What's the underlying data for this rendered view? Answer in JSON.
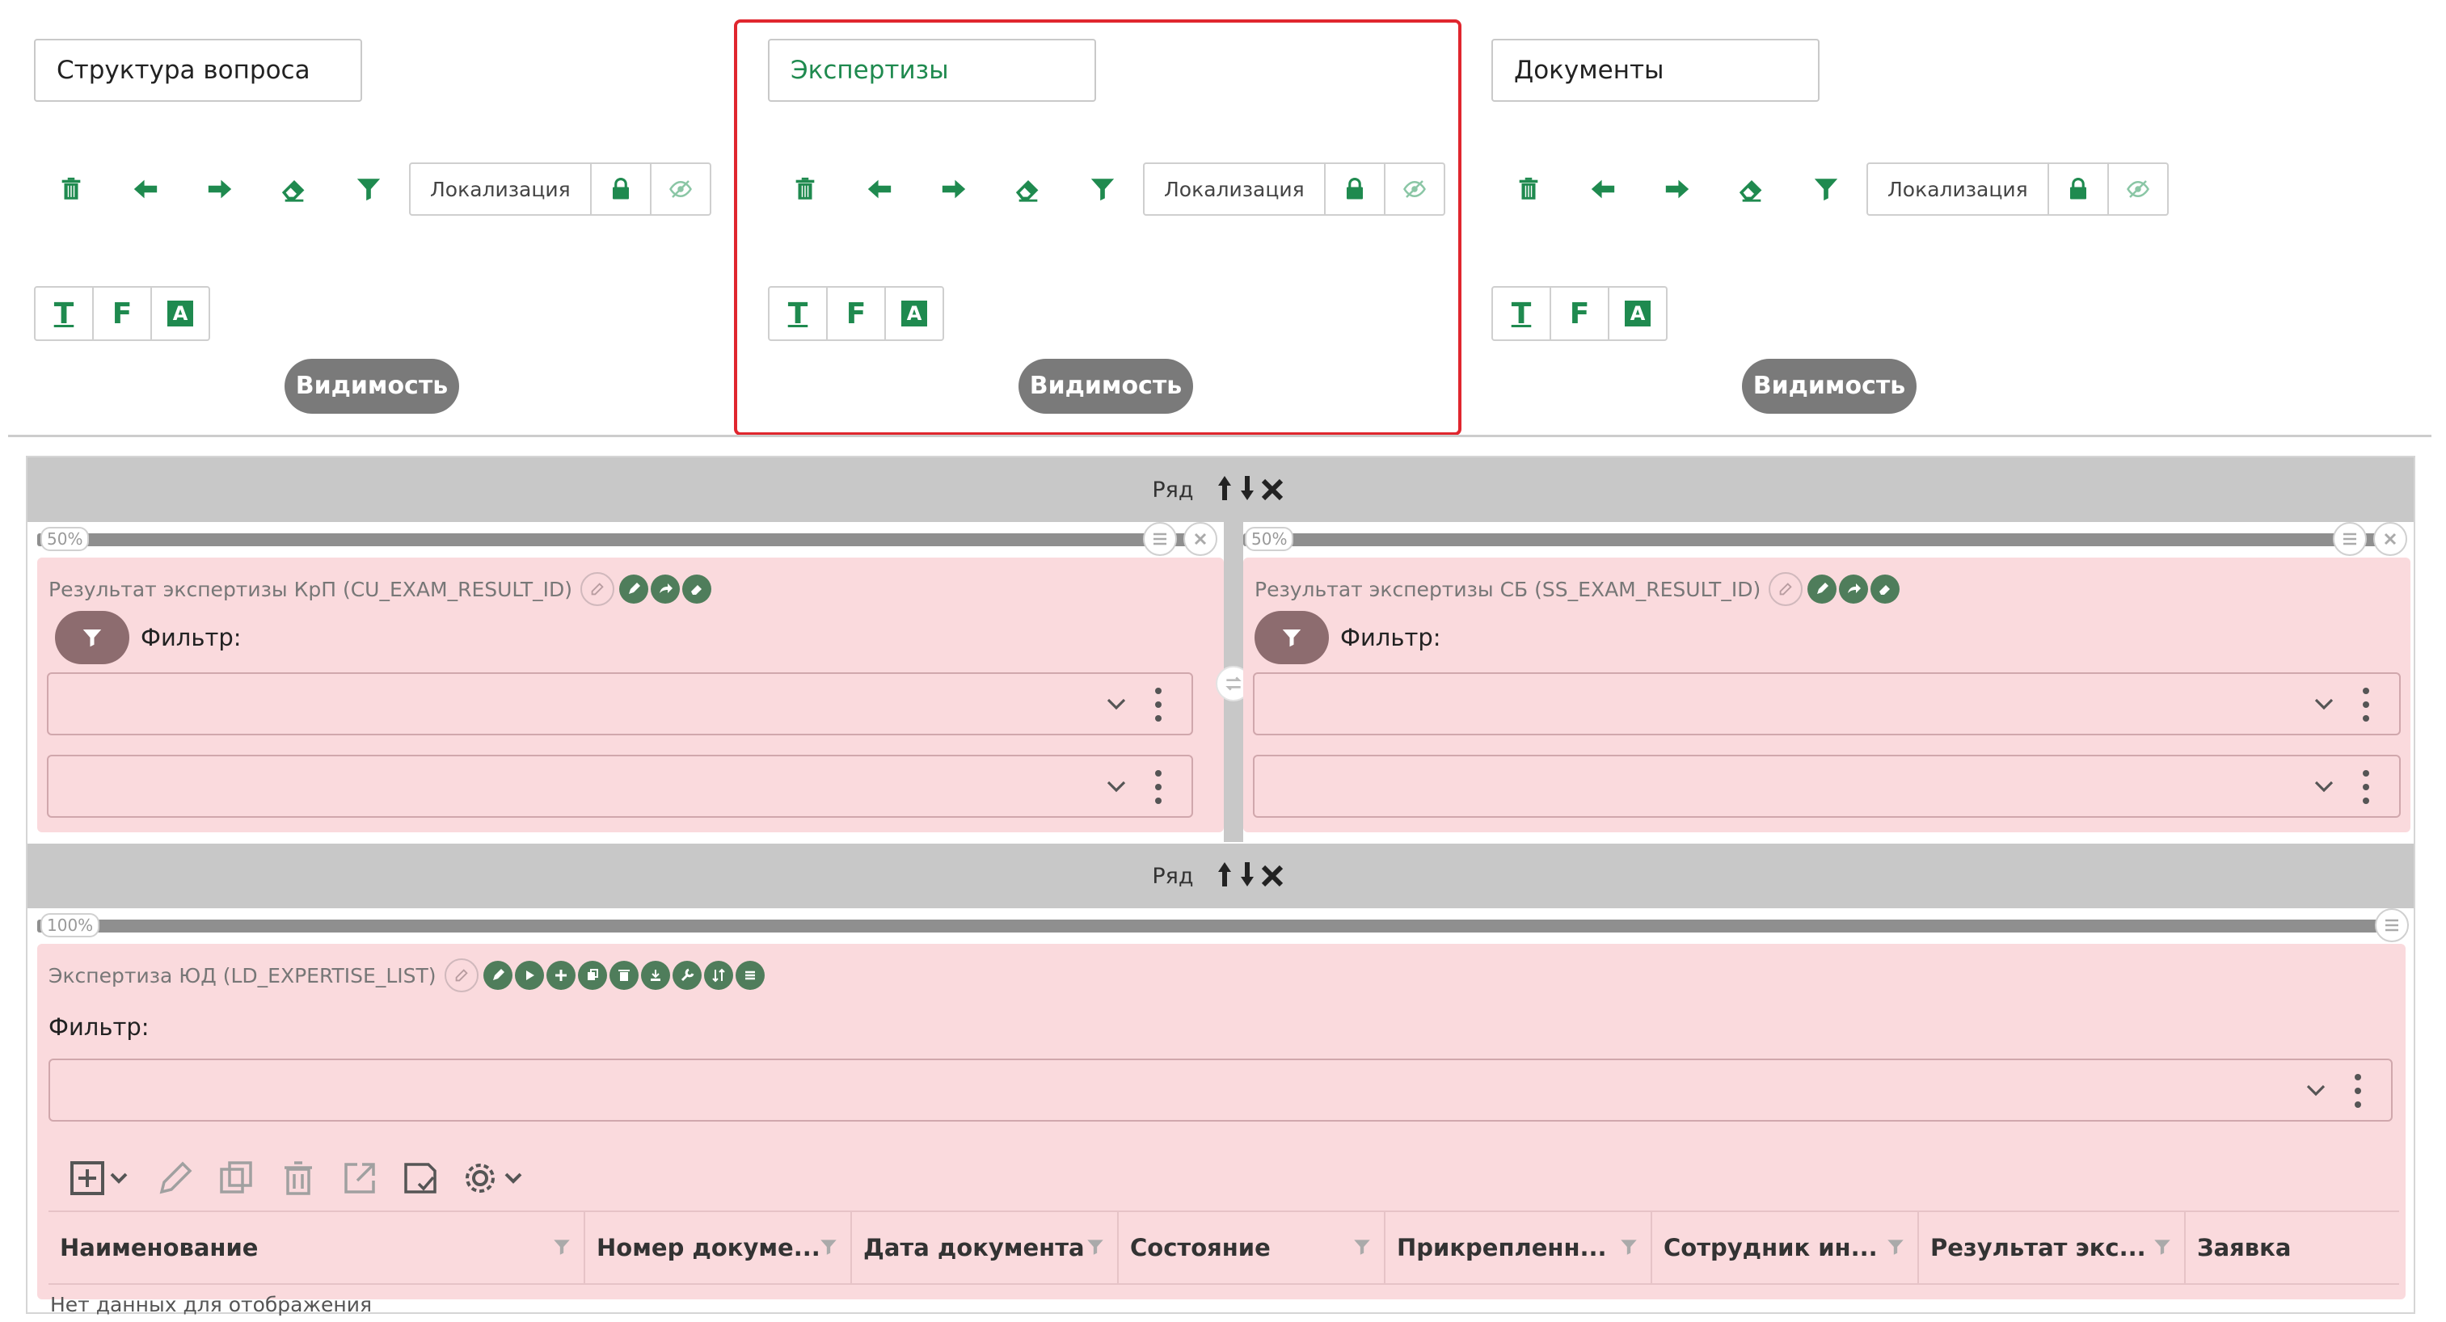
{
  "tabs": [
    {
      "title": "Структура вопроса",
      "localization": "Локализация",
      "visibility": "Видимость",
      "format": [
        "T",
        "F",
        "A"
      ],
      "selected": false
    },
    {
      "title": "Экспертизы",
      "localization": "Локализация",
      "visibility": "Видимость",
      "format": [
        "T",
        "F",
        "A"
      ],
      "selected": true
    },
    {
      "title": "Документы",
      "localization": "Локализация",
      "visibility": "Видимость",
      "format": [
        "T",
        "F",
        "A"
      ],
      "selected": false
    }
  ],
  "icons": {
    "toolbar": [
      "trash-icon",
      "arrow-left-icon",
      "arrow-right-icon",
      "eraser-icon",
      "filter-icon"
    ],
    "lock": "lock-icon",
    "hidden": "eye-slash-icon"
  },
  "colors": {
    "accent": "#1f8a4f",
    "selected_border": "#e0262e",
    "widget_bg": "#fadadd",
    "row_bar": "#c8c8c8"
  },
  "rows": [
    {
      "label": "Ряд",
      "columns": [
        {
          "percent": "50%",
          "widget_title": "Результат экспертизы КрП (CU_EXAM_RESULT_ID)",
          "filter_label": "Фильтр:"
        },
        {
          "percent": "50%",
          "widget_title": "Результат экспертизы СБ (SS_EXAM_RESULT_ID)",
          "filter_label": "Фильтр:"
        }
      ]
    },
    {
      "label": "Ряд",
      "columns": [
        {
          "percent": "100%",
          "widget_title": "Экспертиза ЮД (LD_EXPERTISE_LIST)",
          "filter_label": "Фильтр:"
        }
      ]
    }
  ],
  "grid": {
    "columns": [
      "Наименование",
      "Номер докуме...",
      "Дата документа",
      "Состояние",
      "Прикрепленн...",
      "Сотрудник ин...",
      "Результат экс...",
      "Заявка"
    ],
    "empty_text": "Нет данных для отображения"
  }
}
